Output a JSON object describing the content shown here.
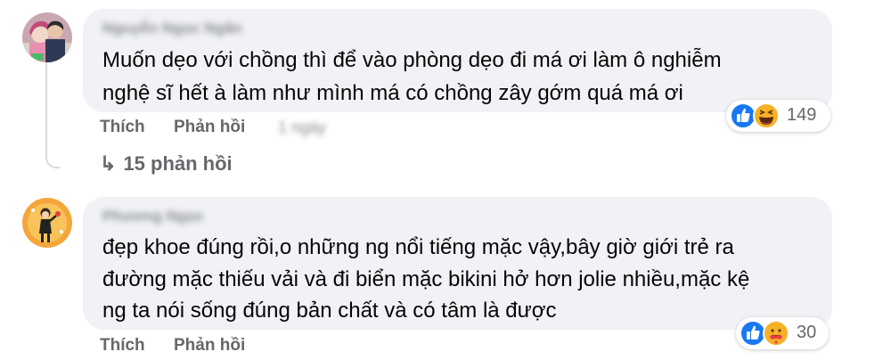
{
  "comments": [
    {
      "author": "Nguyễn Ngọc Ngân",
      "lines": [
        "Muốn dẹo với chồng thì để vào phòng dẹo đi má ơi làm ô nghiễm",
        "nghệ sĩ hết à làm như mình má có chồng zây gớm quá má ơi"
      ],
      "like_label": "Thích",
      "reply_label": "Phản hồi",
      "time": "1 ngày",
      "reaction_icons": [
        "like-icon",
        "haha-icon"
      ],
      "reaction_count": "149"
    },
    {
      "author": "Phương Ngọc",
      "lines": [
        "đẹp khoe đúng rồi,o những ng nổi tiếng mặc vậy,bây giờ giới trẻ ra",
        "đường mặc thiếu vải và đi biển mặc bikini hở hơn jolie nhiều,mặc kệ",
        "ng ta nói sống đúng bản chất và có tâm là được"
      ],
      "like_label": "Thích",
      "reply_label": "Phản hồi",
      "reaction_icons": [
        "like-icon",
        "care-icon"
      ],
      "reaction_count": "30"
    }
  ],
  "replies_link": {
    "arrow": "↳",
    "label": "15 phản hồi"
  },
  "colors": {
    "bubble": "#f0f2f5",
    "text": "#050505",
    "muted": "#65676b",
    "like_blue": "#1877f2",
    "haha_yellow": "#f7b125",
    "thread_line": "#d8dadf"
  }
}
